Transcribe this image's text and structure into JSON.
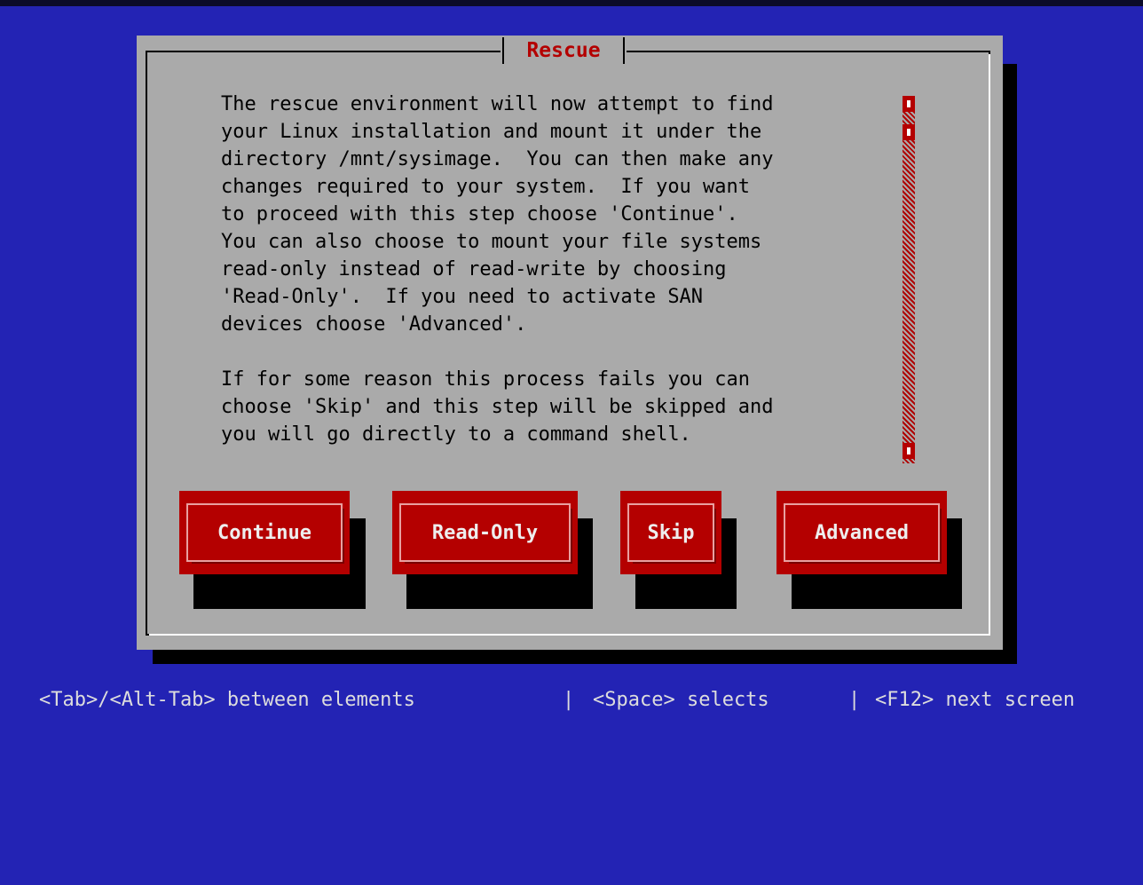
{
  "dialog": {
    "title": "Rescue",
    "body_lines": [
      "The rescue environment will now attempt to find",
      "your Linux installation and mount it under the",
      "directory /mnt/sysimage.  You can then make any",
      "changes required to your system.  If you want",
      "to proceed with this step choose 'Continue'.",
      "You can also choose to mount your file systems",
      "read-only instead of read-write by choosing",
      "'Read-Only'.  If you need to activate SAN",
      "devices choose 'Advanced'.",
      "",
      "If for some reason this process fails you can",
      "choose 'Skip' and this step will be skipped and",
      "you will go directly to a command shell."
    ],
    "buttons": {
      "continue": "Continue",
      "read_only": "Read-Only",
      "skip": "Skip",
      "advanced": "Advanced"
    }
  },
  "helpbar": {
    "item1": "<Tab>/<Alt-Tab> between elements",
    "sep1": "|",
    "item2": "<Space> selects",
    "sep2": "|",
    "item3": "<F12> next screen"
  },
  "colors": {
    "background": "#2323b4",
    "dialog": "#aaaaaa",
    "accent": "#b40000"
  }
}
